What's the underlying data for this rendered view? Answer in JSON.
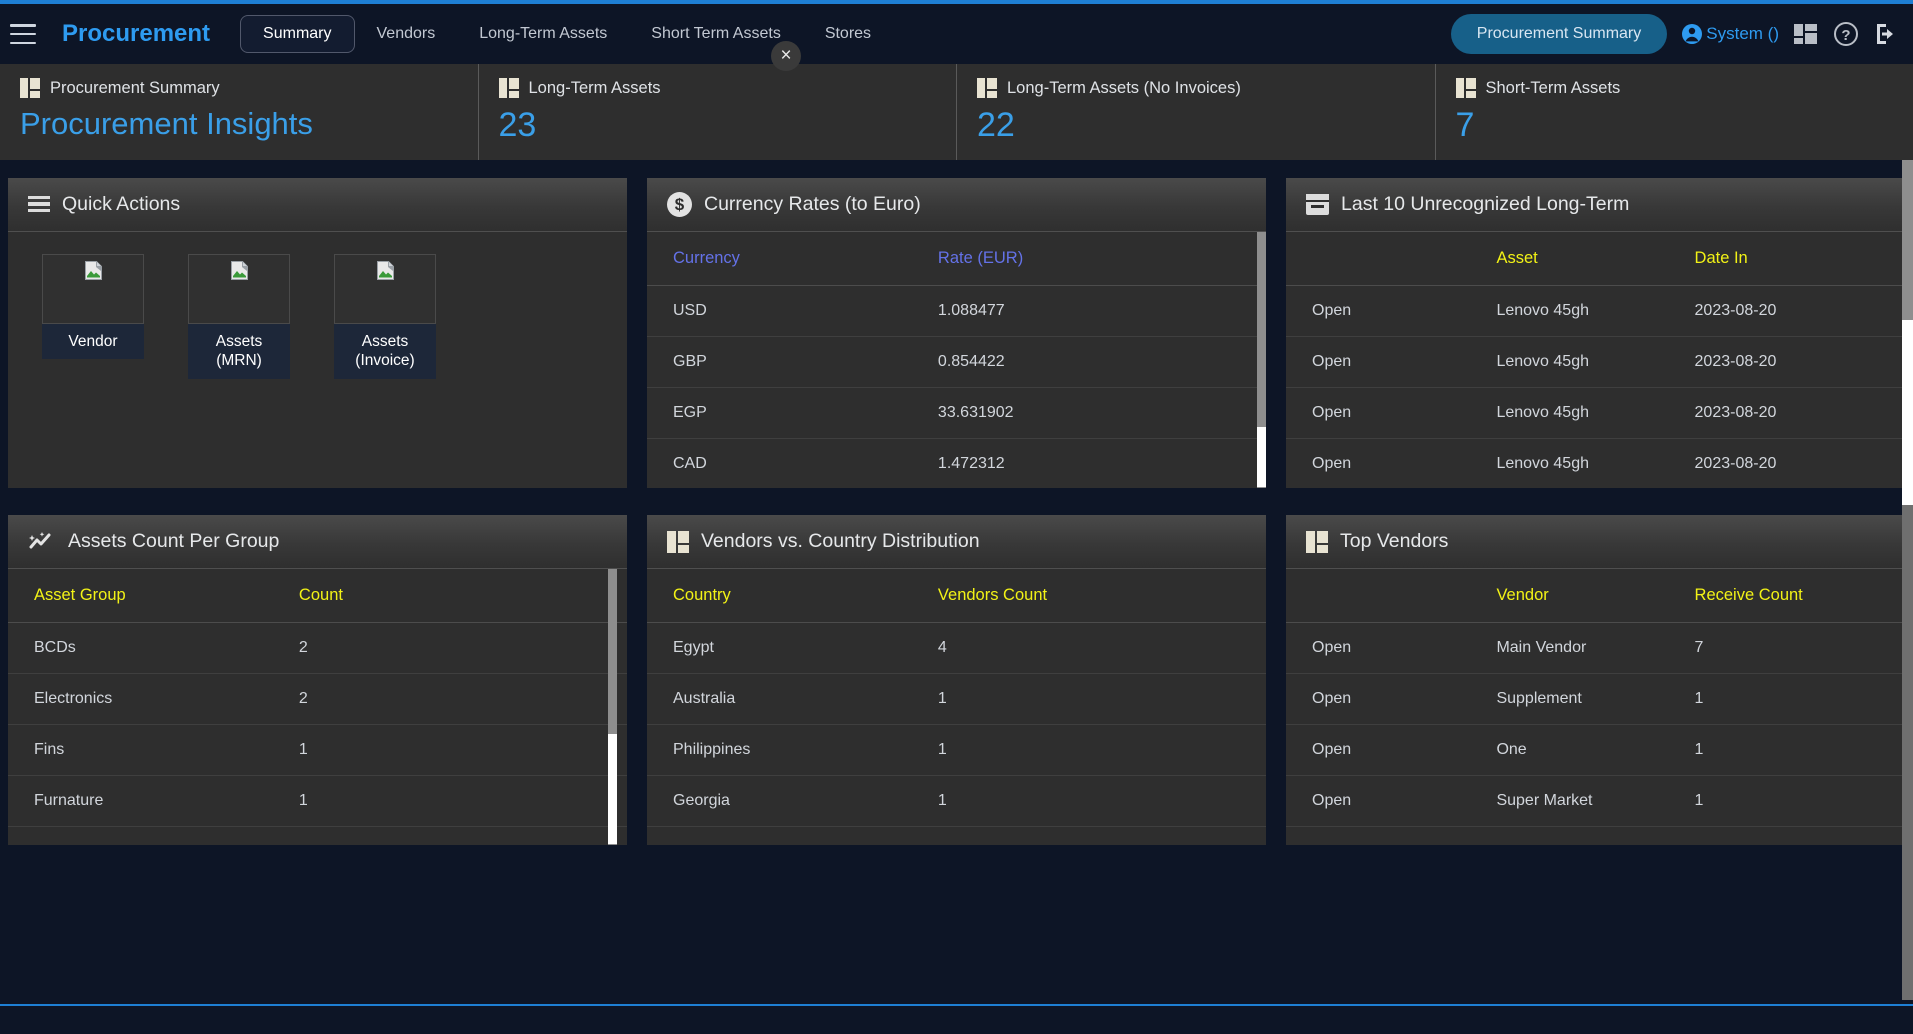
{
  "accent_color": "#1e7fd4",
  "header": {
    "menu_icon": "hamburger-icon",
    "brand": "Procurement",
    "tabs": [
      {
        "label": "Summary",
        "active": true
      },
      {
        "label": "Vendors",
        "active": false
      },
      {
        "label": "Long-Term Assets",
        "active": false
      },
      {
        "label": "Short Term Assets",
        "active": false
      },
      {
        "label": "Stores",
        "active": false
      }
    ],
    "context_pill": "Procurement Summary",
    "user_label": "System ()",
    "user_icon": "user-circle-icon",
    "apps_icon": "grid-apps-icon",
    "help_icon": "question-mark-icon",
    "logout_icon": "sign-out-icon"
  },
  "kpis": [
    {
      "icon": "grid-squares-icon",
      "title": "Procurement Summary",
      "value": "Procurement Insights"
    },
    {
      "icon": "grid-squares-icon",
      "title": "Long-Term Assets",
      "value": "23"
    },
    {
      "icon": "grid-squares-icon",
      "title": "Long-Term Assets (No Invoices)",
      "value": "22"
    },
    {
      "icon": "grid-squares-icon",
      "title": "Short-Term Assets",
      "value": "7"
    }
  ],
  "close_button": "×",
  "quick_actions": {
    "icon": "list-lines-icon",
    "title": "Quick Actions",
    "tiles": [
      {
        "label": "Vendor",
        "icon": "broken-image-icon"
      },
      {
        "label": "Assets (MRN)",
        "icon": "broken-image-icon"
      },
      {
        "label": "Assets (Invoice)",
        "icon": "broken-image-icon"
      }
    ]
  },
  "currency_rates": {
    "icon": "dollar-circle-icon",
    "title": "Currency Rates (to Euro)",
    "columns": [
      "Currency",
      "Rate (EUR)"
    ],
    "rows": [
      [
        "USD",
        "1.088477"
      ],
      [
        "GBP",
        "0.854422"
      ],
      [
        "EGP",
        "33.631902"
      ],
      [
        "CAD",
        "1.472312"
      ]
    ]
  },
  "unrecognized_long_term": {
    "icon": "archive-box-icon",
    "title": "Last 10 Unrecognized Long-Term",
    "columns": [
      "",
      "Asset",
      "Date In"
    ],
    "rows": [
      [
        "Open",
        "Lenovo 45gh",
        "2023-08-20"
      ],
      [
        "Open",
        "Lenovo 45gh",
        "2023-08-20"
      ],
      [
        "Open",
        "Lenovo 45gh",
        "2023-08-20"
      ],
      [
        "Open",
        "Lenovo 45gh",
        "2023-08-20"
      ]
    ]
  },
  "assets_count_per_group": {
    "icon": "trend-sparkle-icon",
    "title": "Assets Count Per Group",
    "columns": [
      "Asset Group",
      "Count"
    ],
    "rows": [
      [
        "BCDs",
        "2"
      ],
      [
        "Electronics",
        "2"
      ],
      [
        "Fins",
        "1"
      ],
      [
        "Furnature",
        "1"
      ]
    ]
  },
  "vendors_vs_country": {
    "icon": "grid-squares-icon",
    "title": "Vendors vs. Country Distribution",
    "columns": [
      "Country",
      "Vendors Count"
    ],
    "rows": [
      [
        "Egypt",
        "4"
      ],
      [
        "Australia",
        "1"
      ],
      [
        "Philippines",
        "1"
      ],
      [
        "Georgia",
        "1"
      ]
    ]
  },
  "top_vendors": {
    "icon": "grid-squares-icon",
    "title": "Top Vendors",
    "columns": [
      "",
      "Vendor",
      "Receive Count"
    ],
    "rows": [
      [
        "Open",
        "Main Vendor",
        "7"
      ],
      [
        "Open",
        "Supplement",
        "1"
      ],
      [
        "Open",
        "One",
        "1"
      ],
      [
        "Open",
        "Super Market",
        "1"
      ]
    ]
  },
  "chart_data": {
    "type": "table",
    "title": "Assets Count Per Group",
    "categories": [
      "BCDs",
      "Electronics",
      "Fins",
      "Furnature"
    ],
    "values": [
      2,
      2,
      1,
      1
    ],
    "xlabel": "Asset Group",
    "ylabel": "Count"
  }
}
